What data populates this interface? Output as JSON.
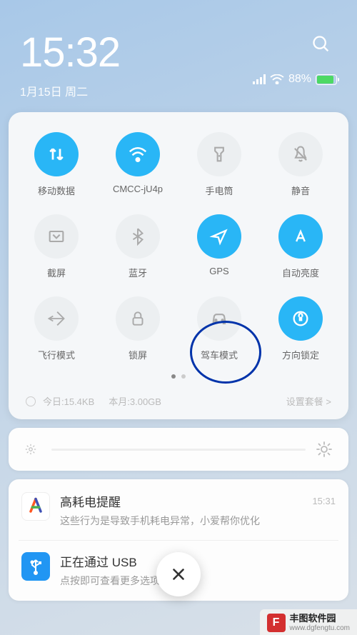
{
  "status": {
    "time": "15:32",
    "date": "1月15日 周二",
    "battery_pct": "88%"
  },
  "tiles": [
    {
      "id": "data",
      "label": "移动数据",
      "on": true
    },
    {
      "id": "wifi",
      "label": "CMCC-jU4p",
      "on": true
    },
    {
      "id": "torch",
      "label": "手电筒",
      "on": false
    },
    {
      "id": "mute",
      "label": "静音",
      "on": false
    },
    {
      "id": "screenshot",
      "label": "截屏",
      "on": false
    },
    {
      "id": "bt",
      "label": "蓝牙",
      "on": false
    },
    {
      "id": "gps",
      "label": "GPS",
      "on": true
    },
    {
      "id": "autobright",
      "label": "自动亮度",
      "on": true
    },
    {
      "id": "airplane",
      "label": "飞行模式",
      "on": false
    },
    {
      "id": "lock",
      "label": "锁屏",
      "on": false
    },
    {
      "id": "drive",
      "label": "驾车模式",
      "on": false
    },
    {
      "id": "rotlock",
      "label": "方向锁定",
      "on": true
    }
  ],
  "data_usage": {
    "today_label": "今日:15.4KB",
    "month_label": "本月:3.00GB",
    "plan_label": "设置套餐 >"
  },
  "notifications": [
    {
      "icon": "ai",
      "title": "高耗电提醒",
      "time": "15:31",
      "body": "这些行为是导致手机耗电异常，小爱帮你优化"
    },
    {
      "icon": "usb",
      "title": "正在通过 USB",
      "time": "",
      "body": "点按即可查看更多选项。"
    }
  ],
  "watermark": {
    "name": "丰图软件园",
    "url": "www.dgfengtu.com"
  }
}
